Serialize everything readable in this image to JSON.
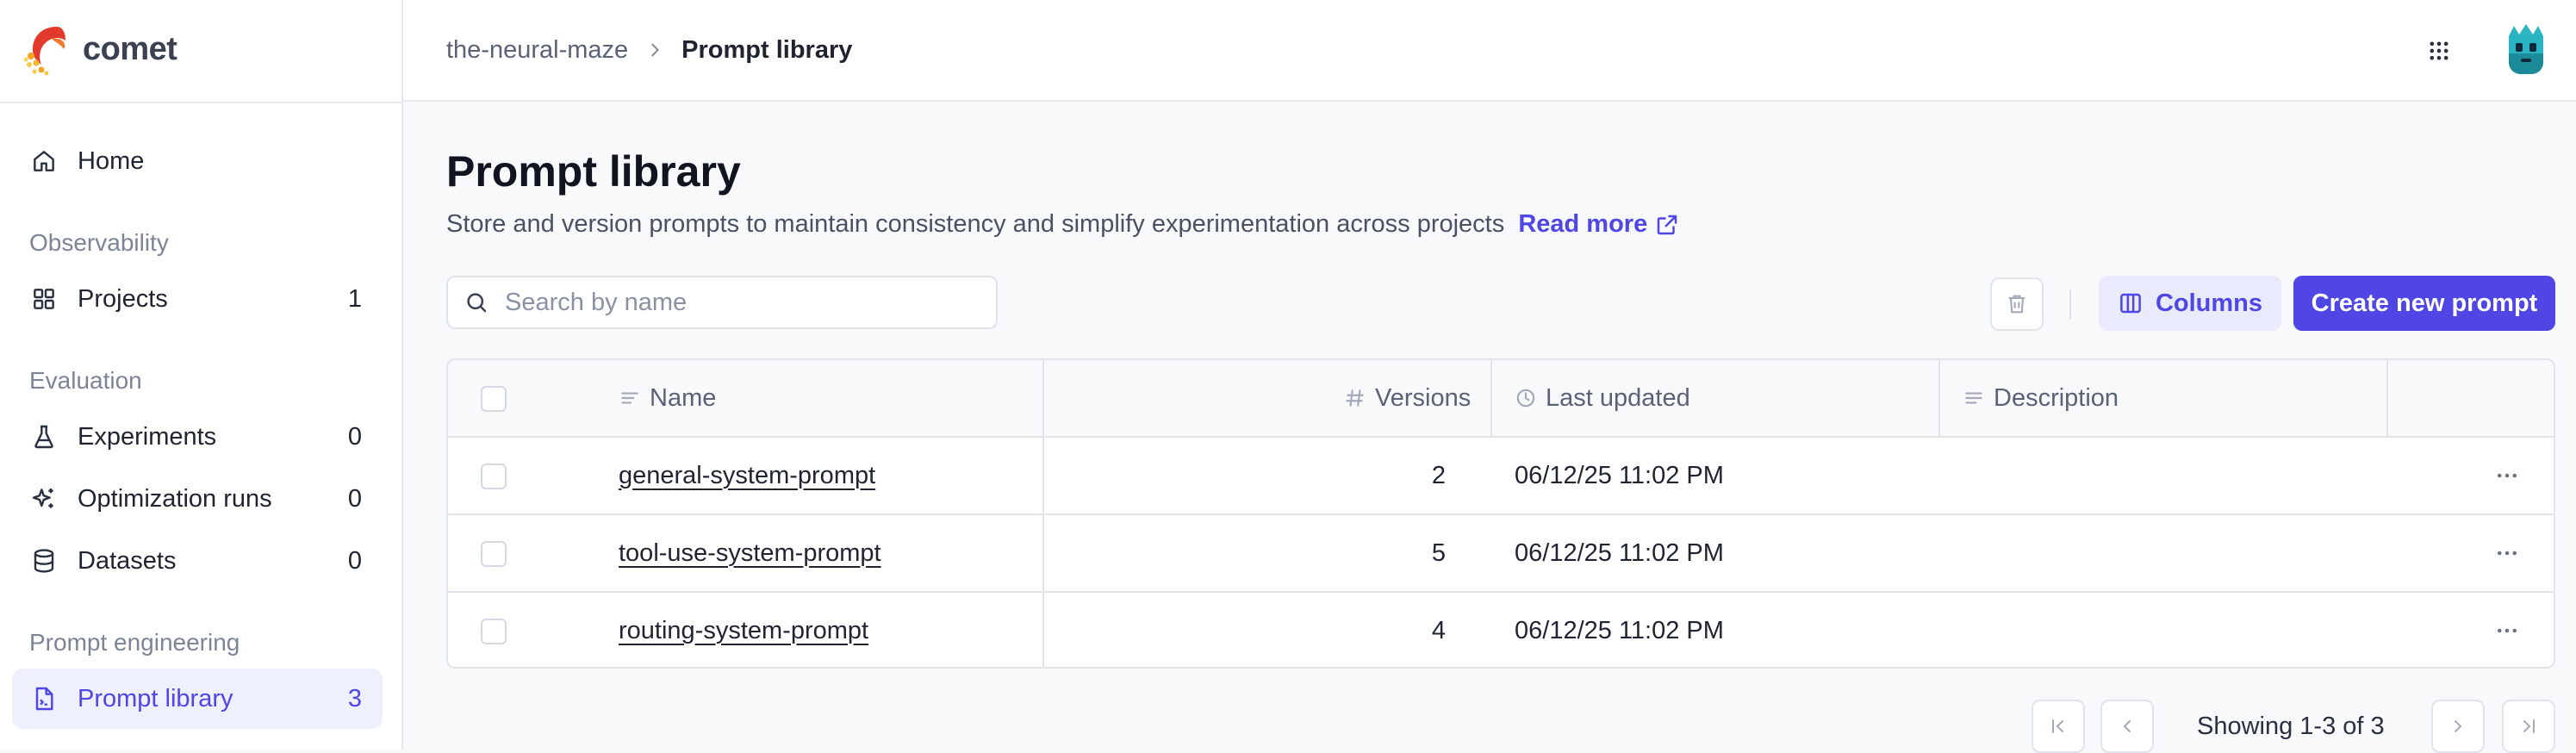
{
  "app": {
    "logo_text": "comet"
  },
  "sidebar": {
    "home": {
      "label": "Home",
      "icon": "home-icon"
    },
    "sections": [
      {
        "label": "Observability"
      },
      {
        "label": "Evaluation"
      },
      {
        "label": "Prompt engineering"
      }
    ],
    "items": [
      {
        "label": "Projects",
        "count": "1",
        "icon": "grid-icon"
      },
      {
        "label": "Experiments",
        "count": "0",
        "icon": "flask-icon"
      },
      {
        "label": "Optimization runs",
        "count": "0",
        "icon": "sparkle-icon"
      },
      {
        "label": "Datasets",
        "count": "0",
        "icon": "database-icon"
      },
      {
        "label": "Prompt library",
        "count": "3",
        "icon": "prompt-file-icon",
        "active": true
      }
    ]
  },
  "breadcrumb": {
    "workspace": "the-neural-maze",
    "current": "Prompt library"
  },
  "page": {
    "title": "Prompt library",
    "description": "Store and version prompts to maintain consistency and simplify experimentation across projects",
    "read_more": "Read more"
  },
  "search": {
    "placeholder": "Search by name",
    "value": ""
  },
  "toolbar": {
    "columns_label": "Columns",
    "create_label": "Create new prompt"
  },
  "table": {
    "headers": {
      "name": "Name",
      "versions": "Versions",
      "last_updated": "Last updated",
      "description": "Description"
    },
    "rows": [
      {
        "name": "general-system-prompt",
        "versions": "2",
        "last_updated": "06/12/25 11:02 PM",
        "description": ""
      },
      {
        "name": "tool-use-system-prompt",
        "versions": "5",
        "last_updated": "06/12/25 11:02 PM",
        "description": ""
      },
      {
        "name": "routing-system-prompt",
        "versions": "4",
        "last_updated": "06/12/25 11:02 PM",
        "description": ""
      }
    ]
  },
  "pagination": {
    "text": "Showing 1-3 of 3"
  },
  "colors": {
    "accent": "#5046e5",
    "active_bg": "#eef0fe",
    "border": "#e1e4ea"
  }
}
